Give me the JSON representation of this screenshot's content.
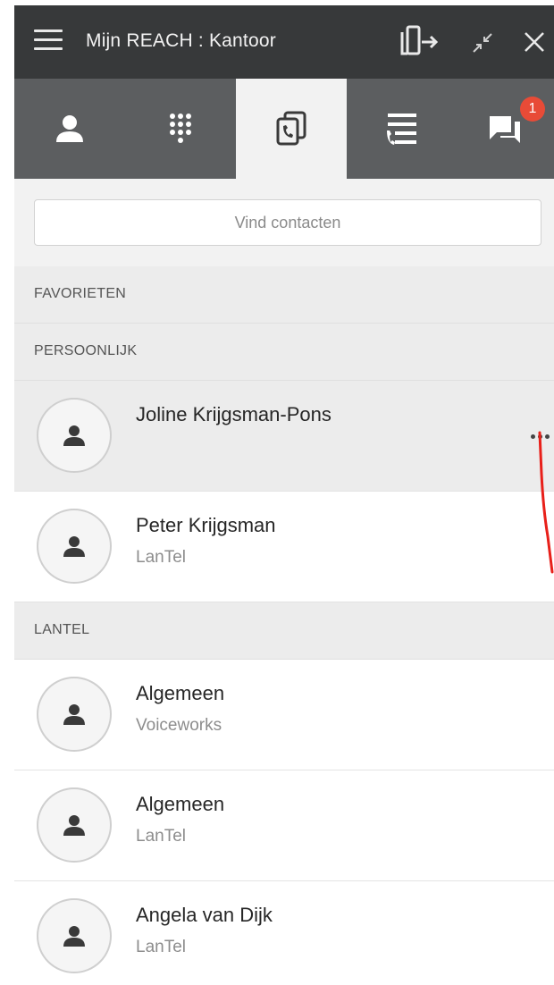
{
  "titlebar": {
    "title": "Mijn REACH : Kantoor",
    "icons": [
      "menu-icon",
      "transfer-icon",
      "minimize-icon",
      "close-icon"
    ]
  },
  "tabs": [
    {
      "icon": "person-icon",
      "active": false
    },
    {
      "icon": "dialpad-icon",
      "active": false
    },
    {
      "icon": "contacts-phone-icon",
      "active": true
    },
    {
      "icon": "call-history-icon",
      "active": false
    },
    {
      "icon": "chat-icon",
      "active": false,
      "badge": "1"
    }
  ],
  "search": {
    "placeholder": "Vind contacten"
  },
  "sections": {
    "favorites": "FAVORIETEN",
    "personal": "PERSOONLIJK",
    "lantel": "LANTEL"
  },
  "contacts": [
    {
      "name": "Joline Krijgsman-Pons",
      "company": ""
    },
    {
      "name": "Peter Krijgsman",
      "company": "LanTel"
    },
    {
      "name": "Algemeen",
      "company": "Voiceworks"
    },
    {
      "name": "Algemeen",
      "company": "LanTel"
    },
    {
      "name": "Angela van Dijk",
      "company": "LanTel"
    }
  ],
  "colors": {
    "titlebar": "#37393a",
    "tabbar": "#5c5e60",
    "active_tab": "#f2f2f2",
    "badge": "#e84b37",
    "annotation": "#e8201a"
  }
}
